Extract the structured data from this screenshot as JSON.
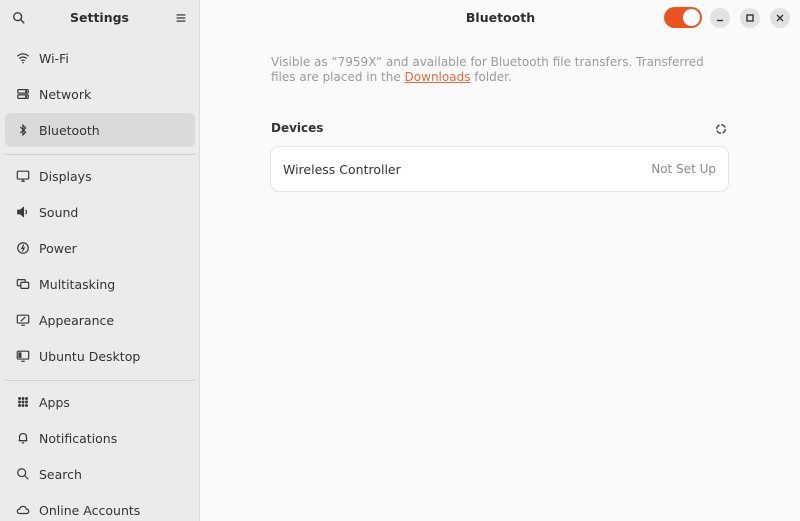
{
  "sidebar": {
    "title": "Settings",
    "items": [
      {
        "label": "Wi-Fi",
        "icon": "wifi-icon"
      },
      {
        "label": "Network",
        "icon": "network-icon"
      },
      {
        "label": "Bluetooth",
        "icon": "bluetooth-icon",
        "active": true
      },
      {
        "label": "Displays",
        "icon": "display-icon"
      },
      {
        "label": "Sound",
        "icon": "sound-icon"
      },
      {
        "label": "Power",
        "icon": "power-icon"
      },
      {
        "label": "Multitasking",
        "icon": "multitasking-icon"
      },
      {
        "label": "Appearance",
        "icon": "appearance-icon"
      },
      {
        "label": "Ubuntu Desktop",
        "icon": "ubuntu-desktop-icon"
      },
      {
        "label": "Apps",
        "icon": "apps-icon"
      },
      {
        "label": "Notifications",
        "icon": "bell-icon"
      },
      {
        "label": "Search",
        "icon": "search-icon"
      },
      {
        "label": "Online Accounts",
        "icon": "cloud-icon"
      }
    ]
  },
  "main": {
    "title": "Bluetooth",
    "bluetooth_enabled": true,
    "description_prefix": "Visible as “7959X” and available for Bluetooth file transfers. Transferred files are placed in the ",
    "description_link": "Downloads",
    "description_suffix": " folder.",
    "devices_header": "Devices",
    "devices": [
      {
        "name": "Wireless Controller",
        "status": "Not Set Up"
      }
    ]
  },
  "colors": {
    "accent": "#e95420",
    "link": "#e06b42",
    "sidebar_bg": "#ebebeb",
    "main_bg": "#fafafa"
  }
}
